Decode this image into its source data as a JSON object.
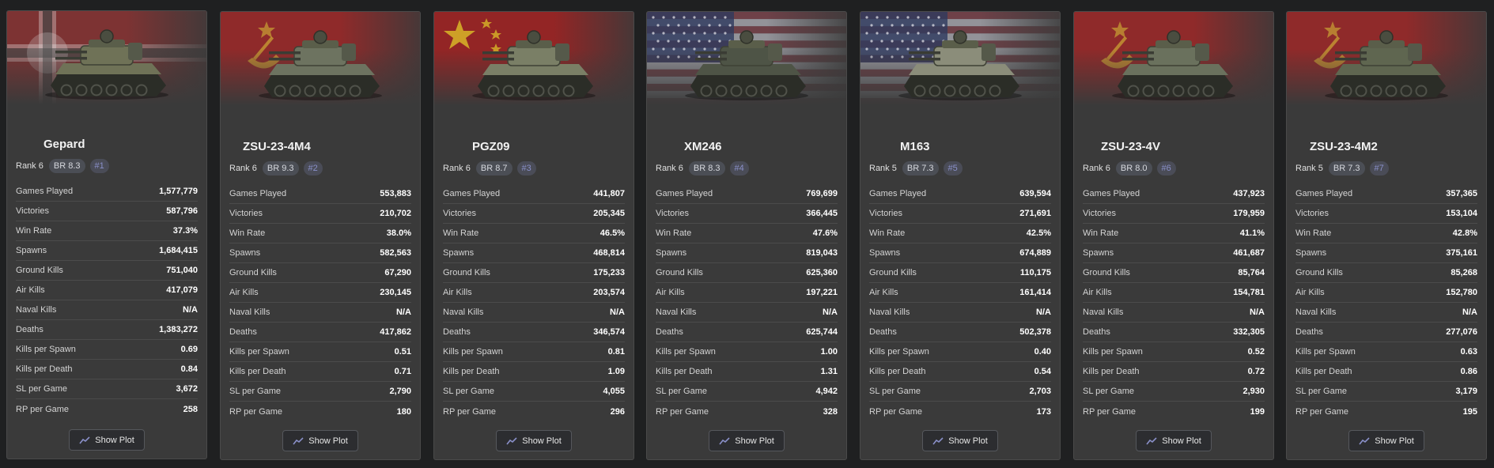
{
  "cards": [
    {
      "name": "Gepard",
      "rank": "Rank 6",
      "br": "BR 8.3",
      "position": "#1",
      "flag": "germany",
      "stats": [
        {
          "label": "Games Played",
          "value": "1,577,779"
        },
        {
          "label": "Victories",
          "value": "587,796"
        },
        {
          "label": "Win Rate",
          "value": "37.3%"
        },
        {
          "label": "Spawns",
          "value": "1,684,415"
        },
        {
          "label": "Ground Kills",
          "value": "751,040"
        },
        {
          "label": "Air Kills",
          "value": "417,079"
        },
        {
          "label": "Naval Kills",
          "value": "N/A"
        },
        {
          "label": "Deaths",
          "value": "1,383,272"
        },
        {
          "label": "Kills per Spawn",
          "value": "0.69"
        },
        {
          "label": "Kills per Death",
          "value": "0.84"
        },
        {
          "label": "SL per Game",
          "value": "3,672"
        },
        {
          "label": "RP per Game",
          "value": "258"
        }
      ],
      "button": "Show Plot"
    },
    {
      "name": "ZSU-23-4M4",
      "rank": "Rank 6",
      "br": "BR 9.3",
      "position": "#2",
      "flag": "ussr",
      "stats": [
        {
          "label": "Games Played",
          "value": "553,883"
        },
        {
          "label": "Victories",
          "value": "210,702"
        },
        {
          "label": "Win Rate",
          "value": "38.0%"
        },
        {
          "label": "Spawns",
          "value": "582,563"
        },
        {
          "label": "Ground Kills",
          "value": "67,290"
        },
        {
          "label": "Air Kills",
          "value": "230,145"
        },
        {
          "label": "Naval Kills",
          "value": "N/A"
        },
        {
          "label": "Deaths",
          "value": "417,862"
        },
        {
          "label": "Kills per Spawn",
          "value": "0.51"
        },
        {
          "label": "Kills per Death",
          "value": "0.71"
        },
        {
          "label": "SL per Game",
          "value": "2,790"
        },
        {
          "label": "RP per Game",
          "value": "180"
        }
      ],
      "button": "Show Plot"
    },
    {
      "name": "PGZ09",
      "rank": "Rank 6",
      "br": "BR 8.7",
      "position": "#3",
      "flag": "china",
      "stats": [
        {
          "label": "Games Played",
          "value": "441,807"
        },
        {
          "label": "Victories",
          "value": "205,345"
        },
        {
          "label": "Win Rate",
          "value": "46.5%"
        },
        {
          "label": "Spawns",
          "value": "468,814"
        },
        {
          "label": "Ground Kills",
          "value": "175,233"
        },
        {
          "label": "Air Kills",
          "value": "203,574"
        },
        {
          "label": "Naval Kills",
          "value": "N/A"
        },
        {
          "label": "Deaths",
          "value": "346,574"
        },
        {
          "label": "Kills per Spawn",
          "value": "0.81"
        },
        {
          "label": "Kills per Death",
          "value": "1.09"
        },
        {
          "label": "SL per Game",
          "value": "4,055"
        },
        {
          "label": "RP per Game",
          "value": "296"
        }
      ],
      "button": "Show Plot"
    },
    {
      "name": "XM246",
      "rank": "Rank 6",
      "br": "BR 8.3",
      "position": "#4",
      "flag": "usa",
      "stats": [
        {
          "label": "Games Played",
          "value": "769,699"
        },
        {
          "label": "Victories",
          "value": "366,445"
        },
        {
          "label": "Win Rate",
          "value": "47.6%"
        },
        {
          "label": "Spawns",
          "value": "819,043"
        },
        {
          "label": "Ground Kills",
          "value": "625,360"
        },
        {
          "label": "Air Kills",
          "value": "197,221"
        },
        {
          "label": "Naval Kills",
          "value": "N/A"
        },
        {
          "label": "Deaths",
          "value": "625,744"
        },
        {
          "label": "Kills per Spawn",
          "value": "1.00"
        },
        {
          "label": "Kills per Death",
          "value": "1.31"
        },
        {
          "label": "SL per Game",
          "value": "4,942"
        },
        {
          "label": "RP per Game",
          "value": "328"
        }
      ],
      "button": "Show Plot"
    },
    {
      "name": "M163",
      "rank": "Rank 5",
      "br": "BR 7.3",
      "position": "#5",
      "flag": "usa",
      "stats": [
        {
          "label": "Games Played",
          "value": "639,594"
        },
        {
          "label": "Victories",
          "value": "271,691"
        },
        {
          "label": "Win Rate",
          "value": "42.5%"
        },
        {
          "label": "Spawns",
          "value": "674,889"
        },
        {
          "label": "Ground Kills",
          "value": "110,175"
        },
        {
          "label": "Air Kills",
          "value": "161,414"
        },
        {
          "label": "Naval Kills",
          "value": "N/A"
        },
        {
          "label": "Deaths",
          "value": "502,378"
        },
        {
          "label": "Kills per Spawn",
          "value": "0.40"
        },
        {
          "label": "Kills per Death",
          "value": "0.54"
        },
        {
          "label": "SL per Game",
          "value": "2,703"
        },
        {
          "label": "RP per Game",
          "value": "173"
        }
      ],
      "button": "Show Plot"
    },
    {
      "name": "ZSU-23-4V",
      "rank": "Rank 6",
      "br": "BR 8.0",
      "position": "#6",
      "flag": "ussr",
      "stats": [
        {
          "label": "Games Played",
          "value": "437,923"
        },
        {
          "label": "Victories",
          "value": "179,959"
        },
        {
          "label": "Win Rate",
          "value": "41.1%"
        },
        {
          "label": "Spawns",
          "value": "461,687"
        },
        {
          "label": "Ground Kills",
          "value": "85,764"
        },
        {
          "label": "Air Kills",
          "value": "154,781"
        },
        {
          "label": "Naval Kills",
          "value": "N/A"
        },
        {
          "label": "Deaths",
          "value": "332,305"
        },
        {
          "label": "Kills per Spawn",
          "value": "0.52"
        },
        {
          "label": "Kills per Death",
          "value": "0.72"
        },
        {
          "label": "SL per Game",
          "value": "2,930"
        },
        {
          "label": "RP per Game",
          "value": "199"
        }
      ],
      "button": "Show Plot"
    },
    {
      "name": "ZSU-23-4M2",
      "rank": "Rank 5",
      "br": "BR 7.3",
      "position": "#7",
      "flag": "ussr",
      "stats": [
        {
          "label": "Games Played",
          "value": "357,365"
        },
        {
          "label": "Victories",
          "value": "153,104"
        },
        {
          "label": "Win Rate",
          "value": "42.8%"
        },
        {
          "label": "Spawns",
          "value": "375,161"
        },
        {
          "label": "Ground Kills",
          "value": "85,268"
        },
        {
          "label": "Air Kills",
          "value": "152,780"
        },
        {
          "label": "Naval Kills",
          "value": "N/A"
        },
        {
          "label": "Deaths",
          "value": "277,076"
        },
        {
          "label": "Kills per Spawn",
          "value": "0.63"
        },
        {
          "label": "Kills per Death",
          "value": "0.86"
        },
        {
          "label": "SL per Game",
          "value": "3,179"
        },
        {
          "label": "RP per Game",
          "value": "195"
        }
      ],
      "button": "Show Plot"
    }
  ],
  "colors": {
    "background": "#1f2021",
    "card": "#3a3a3a",
    "position_text": "#8a90c9",
    "plot_icon": "#8a90c9"
  },
  "icons": {
    "plot_button": "line-chart-icon"
  }
}
